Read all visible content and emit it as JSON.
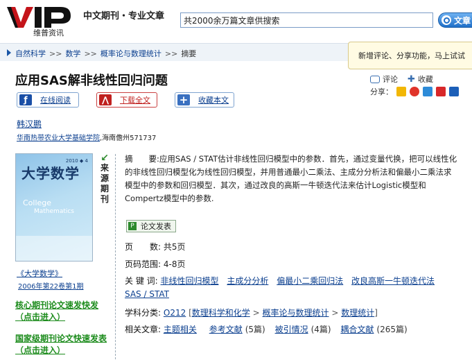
{
  "header": {
    "logo_text": "VIP",
    "logo_sub": "维普资讯",
    "tagline": "中文期刊・专业文章",
    "search_value": "共2000余万篇文章供搜索",
    "search_button": "文章"
  },
  "breadcrumb": {
    "items": [
      "自然科学",
      "数学",
      "概率论与数理统计",
      "摘要"
    ],
    "separator": ">>"
  },
  "notice": "新增评论、分享功能，马上试试",
  "article": {
    "title": "应用SAS解非线性回归问题",
    "actions": {
      "read_online": "在线阅读",
      "download": "下载全文",
      "bookmark": "收藏本文"
    },
    "comment": "评论",
    "collect": "收藏",
    "share_label": "分享：",
    "share_icons": [
      {
        "name": "share-icon-1",
        "color": "#f2b705"
      },
      {
        "name": "share-icon-2",
        "color": "#e0342a"
      },
      {
        "name": "share-icon-3",
        "color": "#2d8bd8"
      },
      {
        "name": "share-icon-4",
        "color": "#d8282a"
      },
      {
        "name": "share-icon-5",
        "color": "#1c5fb8"
      }
    ],
    "author": "韩汉鹏",
    "affiliation_link": "华南热带农业大学基础学院",
    "affiliation_rest": ",海南儋州571737"
  },
  "journal": {
    "cover_title": "大学数学",
    "cover_year": "2010 ◆ 4",
    "cover_en1": "College",
    "cover_en2": "Mathematics",
    "source_tag": "来源期刊",
    "name": "《大学数学》",
    "issue": "2006年第22卷第1期"
  },
  "promos": {
    "core": "核心期刊论文速发快发（点击进入）",
    "national": "国家级期刊论文快速发表（点击进入）"
  },
  "abstract": {
    "label": "摘　　要:",
    "text": "应用SAS / STAT估计非线性回归模型中的参数．首先，通过变量代换，把可以线性化的非线性回归模型化为线性回归模型，并用普通最小二乘法、主成分分析法和偏最小二乘法求模型中的参数和回归模型．其次，通过改良的高斯一牛顿迭代法来估计Logistic模型和Compertz模型中的参数."
  },
  "publish_button": "论文发表",
  "meta": {
    "pages_label": "页　　数:",
    "pages_value": "共5页",
    "range_label": "页码范围:",
    "range_value": "4-8页",
    "keywords_label": "关 键 词:",
    "keywords": [
      "非线性回归模型",
      "主成分分析",
      "偏最小二乘回归法",
      "改良高斯一牛顿迭代法",
      "SAS / STAT"
    ],
    "class_label": "学科分类:",
    "class_code": "O212",
    "class_path": [
      "数理科学和化学",
      "概率论与数理统计",
      "数理统计"
    ],
    "related_label": "相关文章:",
    "related": [
      {
        "label": "主题相关",
        "count": ""
      },
      {
        "label": "参考文献",
        "count": "(5篇)"
      },
      {
        "label": "被引情况",
        "count": "(4篇)"
      },
      {
        "label": "耦合文献",
        "count": "(265篇)"
      }
    ]
  }
}
